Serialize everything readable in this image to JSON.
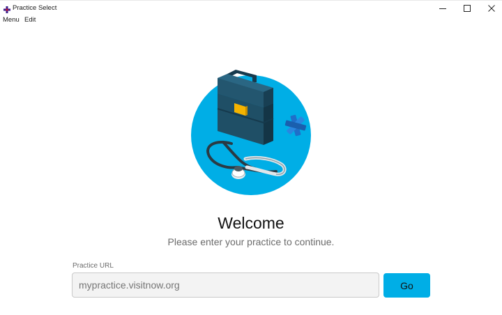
{
  "window": {
    "title": "Practice Select",
    "controls": [
      "minimize-icon",
      "maximize-icon",
      "close-icon"
    ]
  },
  "menu": {
    "items": [
      {
        "label": "Menu"
      },
      {
        "label": "Edit"
      }
    ]
  },
  "main": {
    "illustration_icon": "medical-briefcase-stethoscope-illustration",
    "heading": "Welcome",
    "subtitle": "Please enter your practice to continue.",
    "url_field": {
      "label": "Practice URL",
      "value": "",
      "placeholder": "mypractice.visitnow.org"
    },
    "go_button": "Go"
  },
  "colors": {
    "accent": "#00aee6",
    "illustration_circle": "#00aee6",
    "briefcase": "#1f4f66",
    "latch": "#f5b400",
    "medical_star": "#1f6fc9"
  }
}
